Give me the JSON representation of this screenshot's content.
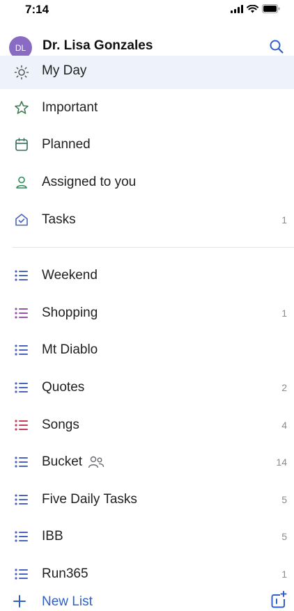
{
  "status_bar": {
    "time": "7:14"
  },
  "header": {
    "avatar_initials": "DL",
    "user_name": "Dr. Lisa Gonzales"
  },
  "smart_lists": [
    {
      "label": "My Day",
      "icon": "sun-icon",
      "count": ""
    },
    {
      "label": "Important",
      "icon": "star-icon",
      "count": ""
    },
    {
      "label": "Planned",
      "icon": "calendar-icon",
      "count": ""
    },
    {
      "label": "Assigned to you",
      "icon": "person-icon",
      "count": ""
    },
    {
      "label": "Tasks",
      "icon": "home-icon",
      "count": "1"
    }
  ],
  "lists": [
    {
      "label": "Weekend",
      "count": "",
      "color": "#4a62c0"
    },
    {
      "label": "Shopping",
      "count": "1",
      "color": "#9b4fb0"
    },
    {
      "label": "Mt Diablo",
      "count": "",
      "color": "#4a62c0"
    },
    {
      "label": "Quotes",
      "count": "2",
      "color": "#4a62c0"
    },
    {
      "label": "Songs",
      "count": "4",
      "color": "#c83a5a"
    },
    {
      "label": "Bucket",
      "count": "14",
      "color": "#4a62c0",
      "shared": true
    },
    {
      "label": "Five Daily Tasks",
      "count": "5",
      "color": "#4a62c0"
    },
    {
      "label": "IBB",
      "count": "5",
      "color": "#4a62c0"
    },
    {
      "label": "Run365",
      "count": "1",
      "color": "#4a62c0"
    }
  ],
  "footer": {
    "new_list_label": "New List"
  },
  "colors": {
    "accent": "#2f5fc8",
    "avatar": "#8a6bc4",
    "selected_row": "#eef3fb"
  }
}
